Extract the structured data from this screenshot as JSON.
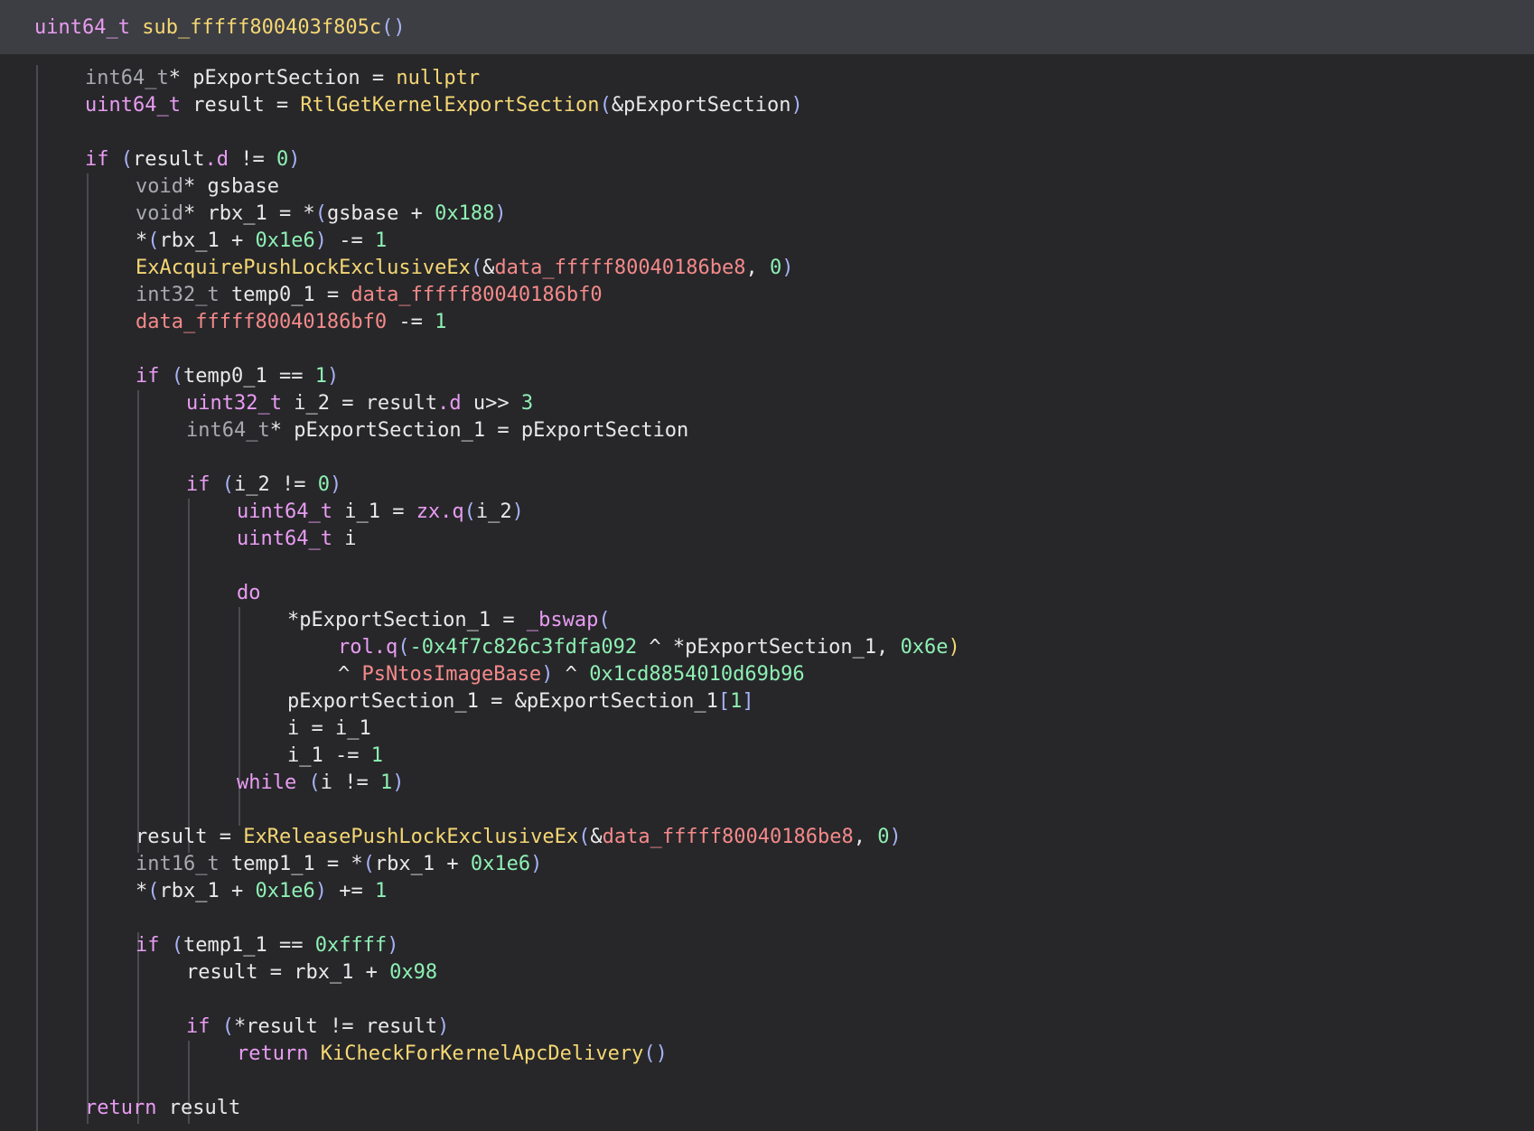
{
  "header": {
    "signature": [
      {
        "t": "uint64_t",
        "c": "k"
      },
      {
        "t": " ",
        "c": "w"
      },
      {
        "t": "sub_fffff800403f805c",
        "c": "f"
      },
      {
        "t": "()",
        "c": "p"
      }
    ]
  },
  "code": {
    "lines": [
      {
        "i": 1,
        "s": [
          {
            "t": "int64_t",
            "c": "t"
          },
          {
            "t": "* pExportSection = ",
            "c": "w"
          },
          {
            "t": "nullptr",
            "c": "f"
          }
        ]
      },
      {
        "i": 1,
        "s": [
          {
            "t": "uint64_t",
            "c": "k"
          },
          {
            "t": " result = ",
            "c": "w"
          },
          {
            "t": "RtlGetKernelExportSection",
            "c": "f"
          },
          {
            "t": "(",
            "c": "p"
          },
          {
            "t": "&pExportSection",
            "c": "w"
          },
          {
            "t": ")",
            "c": "p"
          }
        ]
      },
      {
        "i": 1,
        "s": []
      },
      {
        "i": 1,
        "s": [
          {
            "t": "if",
            "c": "k"
          },
          {
            "t": " ",
            "c": "w"
          },
          {
            "t": "(",
            "c": "p"
          },
          {
            "t": "result",
            "c": "w"
          },
          {
            "t": ".d",
            "c": "m"
          },
          {
            "t": " != ",
            "c": "w"
          },
          {
            "t": "0",
            "c": "n"
          },
          {
            "t": ")",
            "c": "p"
          }
        ]
      },
      {
        "i": 2,
        "s": [
          {
            "t": "void",
            "c": "t"
          },
          {
            "t": "* gsbase",
            "c": "w"
          }
        ]
      },
      {
        "i": 2,
        "s": [
          {
            "t": "void",
            "c": "t"
          },
          {
            "t": "* rbx_1 = *",
            "c": "w"
          },
          {
            "t": "(",
            "c": "p"
          },
          {
            "t": "gsbase + ",
            "c": "w"
          },
          {
            "t": "0x188",
            "c": "n"
          },
          {
            "t": ")",
            "c": "p"
          }
        ]
      },
      {
        "i": 2,
        "s": [
          {
            "t": "*",
            "c": "w"
          },
          {
            "t": "(",
            "c": "p"
          },
          {
            "t": "rbx_1 + ",
            "c": "w"
          },
          {
            "t": "0x1e6",
            "c": "n"
          },
          {
            "t": ")",
            "c": "p"
          },
          {
            "t": " -= ",
            "c": "w"
          },
          {
            "t": "1",
            "c": "n"
          }
        ]
      },
      {
        "i": 2,
        "s": [
          {
            "t": "ExAcquirePushLockExclusiveEx",
            "c": "f"
          },
          {
            "t": "(",
            "c": "p"
          },
          {
            "t": "&",
            "c": "w"
          },
          {
            "t": "data_fffff80040186be8",
            "c": "d"
          },
          {
            "t": ", ",
            "c": "w"
          },
          {
            "t": "0",
            "c": "n"
          },
          {
            "t": ")",
            "c": "p"
          }
        ]
      },
      {
        "i": 2,
        "s": [
          {
            "t": "int32_t",
            "c": "t"
          },
          {
            "t": " temp0_1 = ",
            "c": "w"
          },
          {
            "t": "data_fffff80040186bf0",
            "c": "d"
          }
        ]
      },
      {
        "i": 2,
        "s": [
          {
            "t": "data_fffff80040186bf0",
            "c": "d"
          },
          {
            "t": " -= ",
            "c": "w"
          },
          {
            "t": "1",
            "c": "n"
          }
        ]
      },
      {
        "i": 2,
        "s": []
      },
      {
        "i": 2,
        "s": [
          {
            "t": "if",
            "c": "k"
          },
          {
            "t": " ",
            "c": "w"
          },
          {
            "t": "(",
            "c": "p"
          },
          {
            "t": "temp0_1 == ",
            "c": "w"
          },
          {
            "t": "1",
            "c": "n"
          },
          {
            "t": ")",
            "c": "p"
          }
        ]
      },
      {
        "i": 3,
        "s": [
          {
            "t": "uint32_t",
            "c": "k"
          },
          {
            "t": " i_2 = result",
            "c": "w"
          },
          {
            "t": ".d",
            "c": "m"
          },
          {
            "t": " u>> ",
            "c": "w"
          },
          {
            "t": "3",
            "c": "n"
          }
        ]
      },
      {
        "i": 3,
        "s": [
          {
            "t": "int64_t",
            "c": "t"
          },
          {
            "t": "* pExportSection_1 = pExportSection",
            "c": "w"
          }
        ]
      },
      {
        "i": 3,
        "s": []
      },
      {
        "i": 3,
        "s": [
          {
            "t": "if",
            "c": "k"
          },
          {
            "t": " ",
            "c": "w"
          },
          {
            "t": "(",
            "c": "p"
          },
          {
            "t": "i_2 != ",
            "c": "w"
          },
          {
            "t": "0",
            "c": "n"
          },
          {
            "t": ")",
            "c": "p"
          }
        ]
      },
      {
        "i": 4,
        "s": [
          {
            "t": "uint64_t",
            "c": "k"
          },
          {
            "t": " i_1 = ",
            "c": "w"
          },
          {
            "t": "zx.q",
            "c": "m"
          },
          {
            "t": "(",
            "c": "p"
          },
          {
            "t": "i_2",
            "c": "w"
          },
          {
            "t": ")",
            "c": "p"
          }
        ]
      },
      {
        "i": 4,
        "s": [
          {
            "t": "uint64_t",
            "c": "k"
          },
          {
            "t": " i",
            "c": "w"
          }
        ]
      },
      {
        "i": 4,
        "s": []
      },
      {
        "i": 4,
        "s": [
          {
            "t": "do",
            "c": "k"
          }
        ]
      },
      {
        "i": 5,
        "s": [
          {
            "t": "*pExportSection_1 = ",
            "c": "w"
          },
          {
            "t": "_bswap",
            "c": "m"
          },
          {
            "t": "(",
            "c": "p"
          }
        ]
      },
      {
        "i": 6,
        "s": [
          {
            "t": "rol.q",
            "c": "m"
          },
          {
            "t": "(",
            "c": "p"
          },
          {
            "t": "-0x4f7c826c3fdfa092",
            "c": "n"
          },
          {
            "t": " ^ *pExportSection_1, ",
            "c": "w"
          },
          {
            "t": "0x6e",
            "c": "n"
          },
          {
            "t": ")",
            "c": "f"
          }
        ]
      },
      {
        "i": 6,
        "s": [
          {
            "t": "^ ",
            "c": "w"
          },
          {
            "t": "PsNtosImageBase",
            "c": "d"
          },
          {
            "t": ")",
            "c": "p"
          },
          {
            "t": " ^ ",
            "c": "w"
          },
          {
            "t": "0x1cd8854010d69b96",
            "c": "n"
          }
        ]
      },
      {
        "i": 5,
        "s": [
          {
            "t": "pExportSection_1 = &pExportSection_1",
            "c": "w"
          },
          {
            "t": "[",
            "c": "p"
          },
          {
            "t": "1",
            "c": "n"
          },
          {
            "t": "]",
            "c": "p"
          }
        ]
      },
      {
        "i": 5,
        "s": [
          {
            "t": "i = i_1",
            "c": "w"
          }
        ]
      },
      {
        "i": 5,
        "s": [
          {
            "t": "i_1 -= ",
            "c": "w"
          },
          {
            "t": "1",
            "c": "n"
          }
        ]
      },
      {
        "i": 4,
        "s": [
          {
            "t": "while",
            "c": "k"
          },
          {
            "t": " ",
            "c": "w"
          },
          {
            "t": "(",
            "c": "p"
          },
          {
            "t": "i != ",
            "c": "w"
          },
          {
            "t": "1",
            "c": "n"
          },
          {
            "t": ")",
            "c": "p"
          }
        ]
      },
      {
        "i": 2,
        "s": []
      },
      {
        "i": 2,
        "s": [
          {
            "t": "result = ",
            "c": "w"
          },
          {
            "t": "ExReleasePushLockExclusiveEx",
            "c": "f"
          },
          {
            "t": "(",
            "c": "p"
          },
          {
            "t": "&",
            "c": "w"
          },
          {
            "t": "data_fffff80040186be8",
            "c": "d"
          },
          {
            "t": ", ",
            "c": "w"
          },
          {
            "t": "0",
            "c": "n"
          },
          {
            "t": ")",
            "c": "p"
          }
        ]
      },
      {
        "i": 2,
        "s": [
          {
            "t": "int16_t",
            "c": "t"
          },
          {
            "t": " temp1_1 = *",
            "c": "w"
          },
          {
            "t": "(",
            "c": "p"
          },
          {
            "t": "rbx_1 + ",
            "c": "w"
          },
          {
            "t": "0x1e6",
            "c": "n"
          },
          {
            "t": ")",
            "c": "p"
          }
        ]
      },
      {
        "i": 2,
        "s": [
          {
            "t": "*",
            "c": "w"
          },
          {
            "t": "(",
            "c": "p"
          },
          {
            "t": "rbx_1 + ",
            "c": "w"
          },
          {
            "t": "0x1e6",
            "c": "n"
          },
          {
            "t": ")",
            "c": "p"
          },
          {
            "t": " += ",
            "c": "w"
          },
          {
            "t": "1",
            "c": "n"
          }
        ]
      },
      {
        "i": 2,
        "s": []
      },
      {
        "i": 2,
        "s": [
          {
            "t": "if",
            "c": "k"
          },
          {
            "t": " ",
            "c": "w"
          },
          {
            "t": "(",
            "c": "p"
          },
          {
            "t": "temp1_1 == ",
            "c": "w"
          },
          {
            "t": "0xffff",
            "c": "n"
          },
          {
            "t": ")",
            "c": "p"
          }
        ]
      },
      {
        "i": 3,
        "s": [
          {
            "t": "result = rbx_1 + ",
            "c": "w"
          },
          {
            "t": "0x98",
            "c": "n"
          }
        ]
      },
      {
        "i": 3,
        "s": []
      },
      {
        "i": 3,
        "s": [
          {
            "t": "if",
            "c": "k"
          },
          {
            "t": " ",
            "c": "w"
          },
          {
            "t": "(",
            "c": "p"
          },
          {
            "t": "*result != result",
            "c": "w"
          },
          {
            "t": ")",
            "c": "p"
          }
        ]
      },
      {
        "i": 4,
        "s": [
          {
            "t": "return",
            "c": "k"
          },
          {
            "t": " ",
            "c": "w"
          },
          {
            "t": "KiCheckForKernelApcDelivery",
            "c": "f"
          },
          {
            "t": "()",
            "c": "p"
          }
        ]
      },
      {
        "i": 1,
        "s": []
      },
      {
        "i": 1,
        "s": [
          {
            "t": "return",
            "c": "k"
          },
          {
            "t": " result",
            "c": "w"
          }
        ]
      }
    ]
  }
}
